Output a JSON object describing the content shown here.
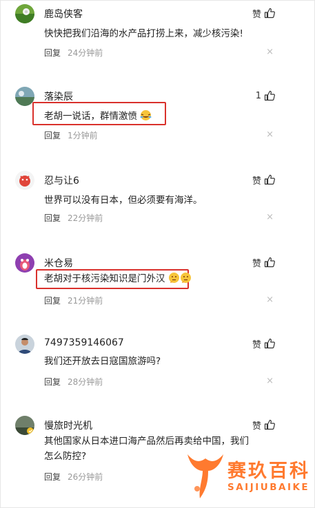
{
  "actions": {
    "reply_label": "回复",
    "close_glyph": "×"
  },
  "comments": [
    {
      "name": "鹿岛侠客",
      "like": "赞",
      "text": "快快把我们沿海的水产品打捞上来，减少核污染!",
      "time": "24分钟前"
    },
    {
      "name": "落染辰",
      "like": "1",
      "text": "老胡一说话，群情激愤",
      "time": "1分钟前"
    },
    {
      "name": "忍与让6",
      "like": "赞",
      "text": "世界可以没有日本，但必须要有海洋。",
      "time": "22分钟前"
    },
    {
      "name": "米仓易",
      "like": "赞",
      "text": "老胡对于核污染知识是门外汉",
      "time": "21分钟前"
    },
    {
      "name": "7497359146067",
      "like": "赞",
      "text": "我们还开放去日寇国旅游吗?",
      "time": "28分钟前"
    },
    {
      "name": "慢旅时光机",
      "like": "赞",
      "text": "其他国家从日本进口海产品然后再卖给中国，我们怎么防控?",
      "time": "26分钟前"
    }
  ],
  "watermark": {
    "title": "赛玖百科",
    "subtitle": "SAIJIUBAIKE"
  },
  "colors": {
    "highlight_box": "#d9302b",
    "watermark": "#ff7a2f",
    "meta_text": "#999999"
  }
}
